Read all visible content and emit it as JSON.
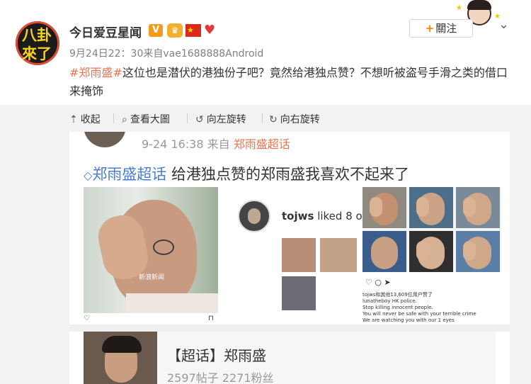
{
  "post": {
    "user_name": "今日爱豆星闻",
    "avatar_text_1": "八卦",
    "avatar_text_2": "來了",
    "badge_v": "V",
    "follow_label": "關注",
    "meta": "9月24日22：30来自vae1688888Android",
    "topic": "#郑雨盛#",
    "text": "这位也是潜伏的港独份子吧？竟然给港独点赞？不想听被盗号手滑之类的借口来掩饰"
  },
  "toolbar": {
    "collapse": "收起",
    "view_large": "查看大圖",
    "rotate_left": "向左旋转",
    "rotate_right": "向右旋转"
  },
  "screenshot": {
    "time": "9-24 16:38",
    "from": "来自",
    "from_topic": "郑雨盛超话",
    "headline_topic": "郑雨盛超话",
    "headline_text": "给港独点赞的郑雨盛我喜欢不起来了",
    "ig_username": "tojws",
    "ig_liked": "liked 8 o",
    "photo_watermark": "新浪新闻",
    "grid_caption_1": "tojws和其他13,609位用户赞了",
    "grid_caption_2": "lunatheboy HK police.",
    "grid_caption_3": "Stop killing innocent people.",
    "grid_caption_4": "You will never be safe with your terrible crime",
    "grid_caption_5": "We are watching you with our 1 eyes",
    "card_title": "【超话】郑雨盛",
    "card_stats": "2597帖子 2271粉丝"
  },
  "colors": {
    "topic": "#eb7350",
    "follow_plus": "#ff8200",
    "super_topic": "#4a7dd1",
    "toolbar_bg": "#f2f2f5"
  },
  "icons": [
    "collapse-icon",
    "search-icon",
    "rotate-left-icon",
    "rotate-right-icon",
    "chevron-down-icon"
  ]
}
